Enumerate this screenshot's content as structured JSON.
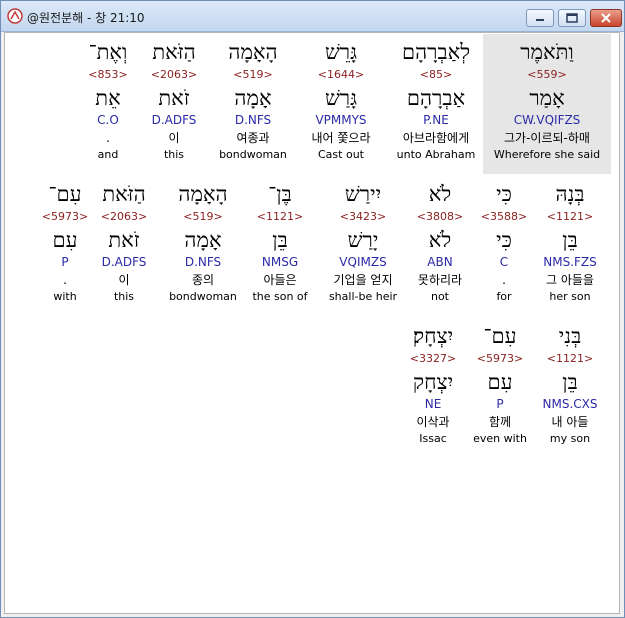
{
  "window": {
    "title": "@원전분해 - 창 21:10",
    "minimize_glyph": "—",
    "maximize_glyph": "□",
    "close_glyph": "✕"
  },
  "selected_word_index": 0,
  "words": [
    {
      "heb": "וַתֹּאמֶר",
      "num": "<559>",
      "lex": "אָמַר",
      "parse": "CW.VQIFZS",
      "kor": "그가-이르되-하매",
      "eng": "Wherefore she said"
    },
    {
      "heb": "לְאַבְרָהָם",
      "num": "<85>",
      "lex": "אַבְרָהָם",
      "parse": "P.NE",
      "kor": "아브라함에게",
      "eng": "unto Abraham"
    },
    {
      "heb": "גָּרֵשׁ",
      "num": "<1644>",
      "lex": "גָּרַשׁ",
      "parse": "VPMMYS",
      "kor": "내어 쫓으라",
      "eng": "Cast out"
    },
    {
      "heb": "הָאָמָה",
      "num": "<519>",
      "lex": "אָמָה",
      "parse": "D.NFS",
      "kor": "여종과",
      "eng": "bondwoman"
    },
    {
      "heb": "הַזֹּאת",
      "num": "<2063>",
      "lex": "זֹאת",
      "parse": "D.ADFS",
      "kor": "이",
      "eng": "this"
    },
    {
      "heb": "וְאֶת־",
      "num": "<853>",
      "lex": "אֵת",
      "parse": "C.O",
      "kor": ".",
      "eng": "and"
    },
    {
      "heb": "בְּנָהּ",
      "num": "<1121>",
      "lex": "בֵּן",
      "parse": "NMS.FZS",
      "kor": "그 아들을",
      "eng": "her son"
    },
    {
      "heb": "כִּי",
      "num": "<3588>",
      "lex": "כִּי",
      "parse": "C",
      "kor": ".",
      "eng": "for"
    },
    {
      "heb": "לֹא",
      "num": "<3808>",
      "lex": "לֹא",
      "parse": "ABN",
      "kor": "못하리라",
      "eng": "not"
    },
    {
      "heb": "יִירַשׁ",
      "num": "<3423>",
      "lex": "יָרַשׁ",
      "parse": "VQIMZS",
      "kor": "기업을 얻지",
      "eng": "shall-be heir"
    },
    {
      "heb": "בֶּן־",
      "num": "<1121>",
      "lex": "בֵּן",
      "parse": "NMSG",
      "kor": "아들은",
      "eng": "the son of"
    },
    {
      "heb": "הָאָמָה",
      "num": "<519>",
      "lex": "אָמָה",
      "parse": "D.NFS",
      "kor": "종의",
      "eng": "bondwoman"
    },
    {
      "heb": "הַזֹּאת",
      "num": "<2063>",
      "lex": "זֹאת",
      "parse": "D.ADFS",
      "kor": "이",
      "eng": "this"
    },
    {
      "heb": "עִם־",
      "num": "<5973>",
      "lex": "עִם",
      "parse": "P",
      "kor": ".",
      "eng": "with"
    },
    {
      "heb": "בְּנִי",
      "num": "<1121>",
      "lex": "בֵּן",
      "parse": "NMS.CXS",
      "kor": "내 아들",
      "eng": "my son"
    },
    {
      "heb": "עִם־",
      "num": "<5973>",
      "lex": "עִם",
      "parse": "P",
      "kor": "함께",
      "eng": "even with"
    },
    {
      "heb": "יִצְחָק׃",
      "num": "<3327>",
      "lex": "יִצְחָק",
      "parse": "NE",
      "kor": "이삭과",
      "eng": "Issac"
    }
  ]
}
